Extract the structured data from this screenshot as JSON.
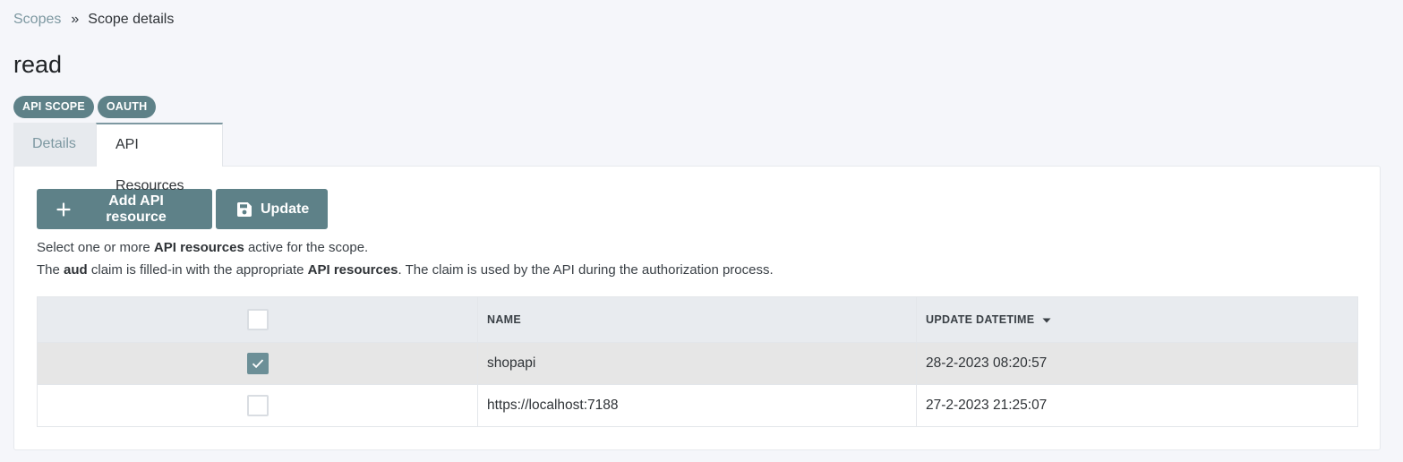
{
  "breadcrumb": {
    "parent": "Scopes",
    "separator": "»",
    "current": "Scope details"
  },
  "page": {
    "title": "read"
  },
  "badges": [
    "API SCOPE",
    "OAUTH"
  ],
  "tabs": [
    {
      "label": "Details",
      "active": false
    },
    {
      "label": "API Resources",
      "active": true
    }
  ],
  "toolbar": {
    "add_label": "Add API resource",
    "update_label": "Update"
  },
  "help": {
    "line1_a": "Select one or more ",
    "line1_b": "API resources",
    "line1_c": " active for the scope.",
    "line2_a": "The ",
    "line2_b": "aud",
    "line2_c": " claim is filled-in with the appropriate ",
    "line2_d": "API resources",
    "line2_e": ". The claim is used by the API during the authorization process."
  },
  "table": {
    "columns": {
      "name": "NAME",
      "updated": "UPDATE DATETIME"
    },
    "sort_column": "UPDATE DATETIME",
    "rows": [
      {
        "checked": true,
        "name": "shopapi",
        "updated": "28-2-2023 08:20:57"
      },
      {
        "checked": false,
        "name": "https://localhost:7188",
        "updated": "27-2-2023 21:25:07"
      }
    ]
  },
  "colors": {
    "accent": "#5e8188",
    "checkbox_checked": "#6c8f97",
    "link": "#7d98a1"
  }
}
